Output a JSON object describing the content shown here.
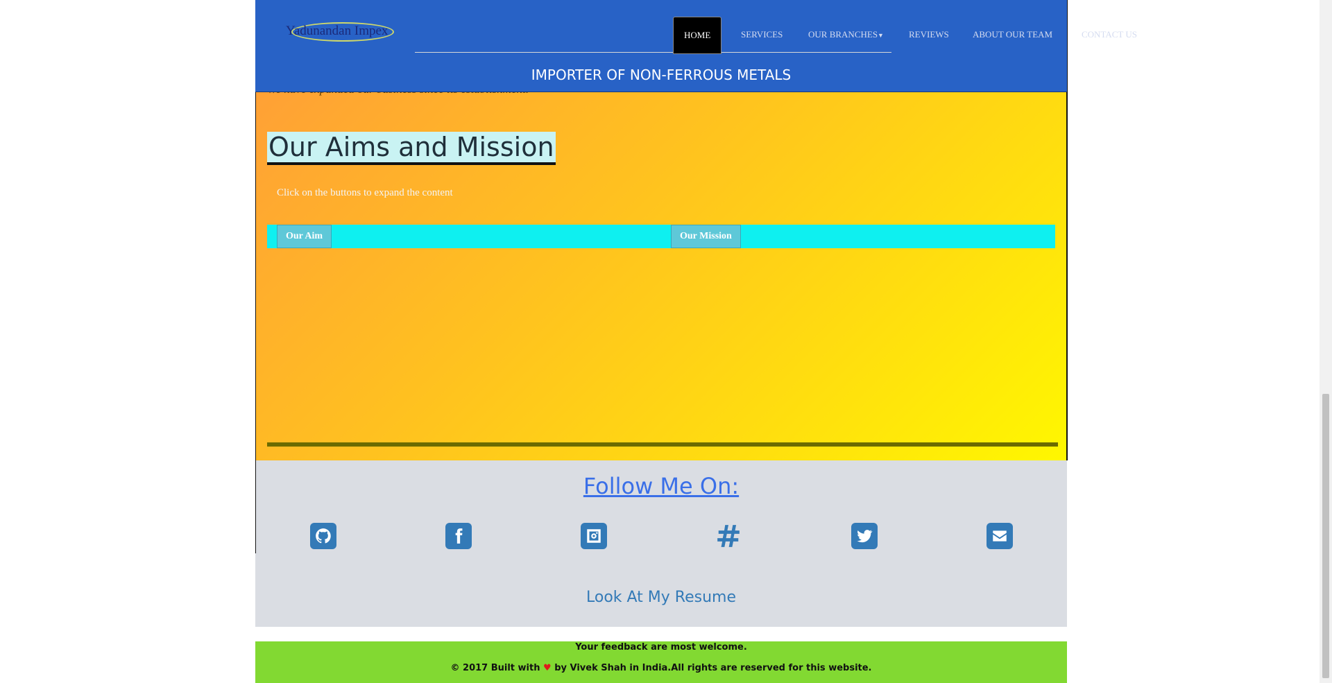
{
  "navbar": {
    "brand": "Yadunandan Impex",
    "items": [
      {
        "label": "HOME"
      },
      {
        "label": "SERVICES"
      },
      {
        "label": "OUR BRANCHES"
      },
      {
        "label": "REVIEWS"
      },
      {
        "label": "ABOUT OUR TEAM"
      },
      {
        "label": "CONTACT US"
      }
    ],
    "tagline": "IMPORTER OF NON-FERROUS METALS"
  },
  "content": {
    "intro": "We have expanded our business since its establishment.",
    "title": "Our Aims and Mission",
    "hint": "Click on the buttons to expand the content",
    "tabs": [
      {
        "label": "Our Aim"
      },
      {
        "label": "Our Mission"
      }
    ]
  },
  "follow": {
    "title": "Follow Me On:",
    "icons": [
      "github-icon",
      "facebook-icon",
      "instagram-icon",
      "slack-icon",
      "twitter-icon",
      "email-icon"
    ],
    "resume": "Look At My Resume"
  },
  "footer": {
    "line1": "Your feedback are most welcome.",
    "line2_prefix": "© 2017 Built with",
    "heart": "♥",
    "line2_suffix": "by Vivek Shah in India.All rights are reserved for this website."
  },
  "colors": {
    "navbar": "#2862c6",
    "tab_bar": "#0ef0f0",
    "footer": "#82d932",
    "social": "#337ab7"
  }
}
